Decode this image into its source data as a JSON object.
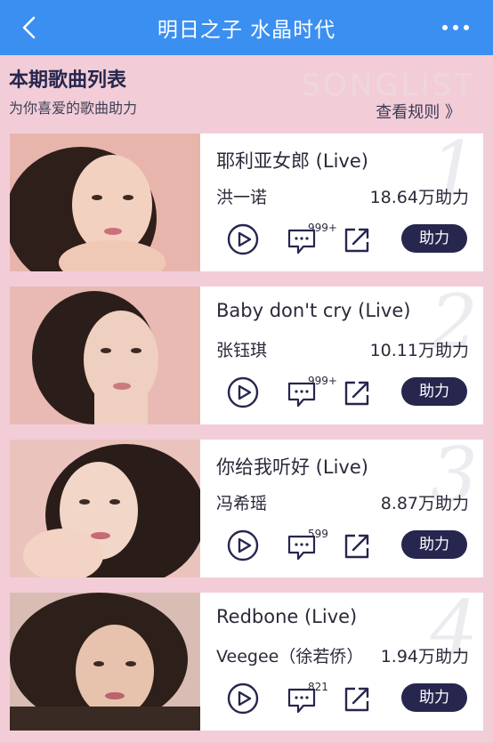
{
  "header": {
    "title": "明日之子 水晶时代"
  },
  "section": {
    "title": "本期歌曲列表",
    "subtitle": "为你喜爱的歌曲助力",
    "watermark": "SONGLIST",
    "rules_link": "查看规则 》"
  },
  "songs": [
    {
      "rank": "1",
      "title": "耶利亚女郎 (Live)",
      "singer": "洪一诺",
      "votes": "18.64万助力",
      "comments": "999+",
      "button": "助力"
    },
    {
      "rank": "2",
      "title": "Baby don't cry (Live)",
      "singer": "张钰琪",
      "votes": "10.11万助力",
      "comments": "999+",
      "button": "助力"
    },
    {
      "rank": "3",
      "title": "你给我听好 (Live)",
      "singer": "冯希瑶",
      "votes": "8.87万助力",
      "comments": "599",
      "button": "助力"
    },
    {
      "rank": "4",
      "title": "Redbone (Live)",
      "singer": "Veegee（徐若侨）",
      "votes": "1.94万助力",
      "comments": "821",
      "button": "助力"
    }
  ],
  "colors": {
    "header_bg": "#3b8ff0",
    "page_bg": "#f2cdd7",
    "button_bg": "#26264f"
  }
}
